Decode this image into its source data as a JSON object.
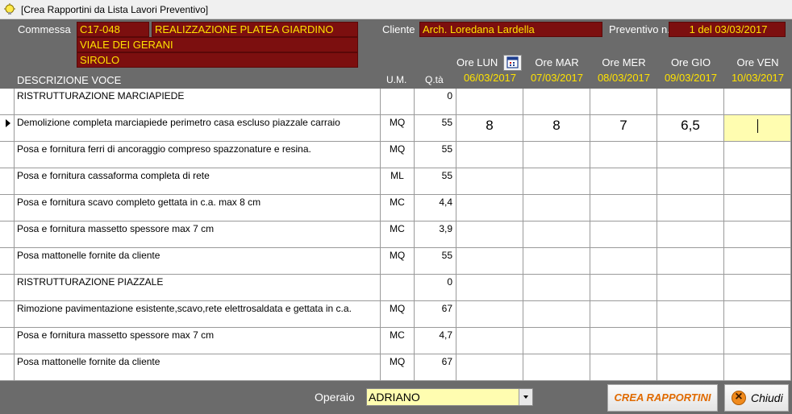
{
  "window": {
    "title": "[Crea Rapportini da Lista Lavori Preventivo]"
  },
  "header": {
    "commessa_label": "Commessa",
    "commessa_code": "C17-048",
    "commessa_desc": "REALIZZAZIONE PLATEA GIARDINO",
    "address": "VIALE DEI GERANI",
    "city": "SIROLO",
    "cliente_label": "Cliente",
    "cliente_value": "Arch. Loredana Lardella",
    "preventivo_label": "Preventivo n.",
    "preventivo_value": "1 del 03/03/2017"
  },
  "columns": {
    "descrizione": "DESCRIZIONE VOCE",
    "um": "U.M.",
    "qta": "Q.tà",
    "days": [
      {
        "name": "Ore LUN",
        "date": "06/03/2017"
      },
      {
        "name": "Ore MAR",
        "date": "07/03/2017"
      },
      {
        "name": "Ore MER",
        "date": "08/03/2017"
      },
      {
        "name": "Ore GIO",
        "date": "09/03/2017"
      },
      {
        "name": "Ore VEN",
        "date": "10/03/2017"
      }
    ]
  },
  "rows": [
    {
      "desc": "RISTRUTTURAZIONE MARCIAPIEDE",
      "um": "",
      "qta": "0",
      "hours": [
        "",
        "",
        "",
        "",
        ""
      ]
    },
    {
      "desc": "Demolizione completa marciapiede perimetro casa escluso piazzale carraio",
      "um": "MQ",
      "qta": "55",
      "hours": [
        "8",
        "8",
        "7",
        "6,5",
        ""
      ]
    },
    {
      "desc": "Posa e fornitura ferri di ancoraggio compreso spazzonature e resina.",
      "um": "MQ",
      "qta": "55",
      "hours": [
        "",
        "",
        "",
        "",
        ""
      ]
    },
    {
      "desc": "Posa e fornitura cassaforma completa di rete",
      "um": "ML",
      "qta": "55",
      "hours": [
        "",
        "",
        "",
        "",
        ""
      ]
    },
    {
      "desc": "Posa e fornitura scavo completo gettata in c.a. max 8 cm",
      "um": "MC",
      "qta": "4,4",
      "hours": [
        "",
        "",
        "",
        "",
        ""
      ]
    },
    {
      "desc": "Posa e fornitura massetto spessore max 7 cm",
      "um": "MC",
      "qta": "3,9",
      "hours": [
        "",
        "",
        "",
        "",
        ""
      ]
    },
    {
      "desc": "Posa mattonelle fornite da cliente",
      "um": "MQ",
      "qta": "55",
      "hours": [
        "",
        "",
        "",
        "",
        ""
      ]
    },
    {
      "desc": "RISTRUTTURAZIONE PIAZZALE",
      "um": "",
      "qta": "0",
      "hours": [
        "",
        "",
        "",
        "",
        ""
      ]
    },
    {
      "desc": "Rimozione pavimentazione esistente,scavo,rete elettrosaldata e gettata in c.a.",
      "um": "MQ",
      "qta": "67",
      "hours": [
        "",
        "",
        "",
        "",
        ""
      ]
    },
    {
      "desc": "Posa e fornitura massetto spessore max 7 cm",
      "um": "MC",
      "qta": "4,7",
      "hours": [
        "",
        "",
        "",
        "",
        ""
      ]
    },
    {
      "desc": "Posa mattonelle fornite da cliente",
      "um": "MQ",
      "qta": "67",
      "hours": [
        "",
        "",
        "",
        "",
        ""
      ]
    }
  ],
  "current_row": 1,
  "current_day": 4,
  "footer": {
    "operaio_label": "Operaio",
    "operaio_value": "ADRIANO",
    "crea_label": "CREA RAPPORTINI",
    "chiudi_label": "Chiudi"
  },
  "icons": {
    "title_icon": "bulb-icon",
    "calendar_icon": "calendar-icon",
    "close_icon": "close-icon"
  },
  "colors": {
    "field_bg": "#7c0f0f",
    "field_text": "#ffe200",
    "active_cell": "#fffdb0",
    "crea_text": "#e06a00"
  }
}
